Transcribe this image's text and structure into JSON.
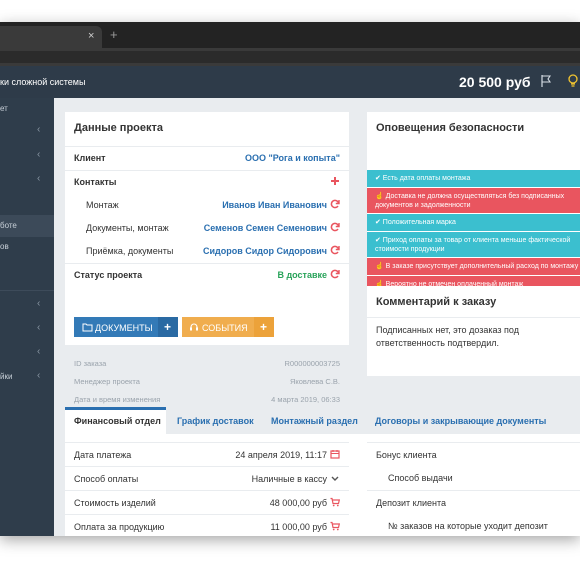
{
  "browser": {
    "tab_close": "×",
    "tab_new": "+"
  },
  "header": {
    "title": "ки сложной системы",
    "balance": "20 500 руб"
  },
  "sidebar": {
    "items": [
      {
        "label": "ет",
        "has_chevron": false
      },
      {
        "label": "",
        "has_chevron": true
      },
      {
        "label": "",
        "has_chevron": true
      },
      {
        "label": "",
        "has_chevron": true
      },
      {
        "label": "боте",
        "has_chevron": false
      },
      {
        "label": "ов",
        "has_chevron": false
      },
      {
        "label": "",
        "has_chevron": true
      },
      {
        "label": "",
        "has_chevron": true
      },
      {
        "label": "",
        "has_chevron": true
      },
      {
        "label": "йки",
        "has_chevron": true
      }
    ],
    "chevron": "‹"
  },
  "project": {
    "title": "Данные проекта",
    "client_label": "Клиент",
    "client_value": "ООО \"Рога и копыта\"",
    "contacts_label": "Контакты",
    "contacts": [
      {
        "role": "Монтаж",
        "name": "Иванов Иван Иванович"
      },
      {
        "role": "Документы, монтаж",
        "name": "Семенов Семен Семенович"
      },
      {
        "role": "Приёмка, документы",
        "name": "Сидоров Сидор Сидорович"
      }
    ],
    "status_label": "Статус проекта",
    "status_value": "В доставке",
    "docs_button": "ДОКУМЕНТЫ",
    "events_button": "СОБЫТИЯ",
    "plus": "+"
  },
  "order_meta": {
    "rows": [
      {
        "label": "ID заказа",
        "value": "R000000003725"
      },
      {
        "label": "Менеджер проекта",
        "value": "Яковлева С.В."
      },
      {
        "label": "Дата и время изменения",
        "value": "4 марта 2019, 06:33"
      }
    ]
  },
  "security": {
    "title": "Оповещения безопасности",
    "alerts": [
      {
        "type": "cyan",
        "text": "✔ Есть дата оплаты монтажа"
      },
      {
        "type": "red",
        "text": "☝ Доставка не должна осуществляться без подписанных документов и задолженности"
      },
      {
        "type": "cyan",
        "text": "✔ Положительная марка"
      },
      {
        "type": "cyan",
        "text": "✔ Приход оплаты за товар от клиента меньше фактической стоимости продукции"
      },
      {
        "type": "red",
        "text": "☝ В заказе присутствует дополнительный расход по монтажу"
      },
      {
        "type": "red",
        "text": "☝ Вероятно не отмечен оплаченный монтаж"
      }
    ]
  },
  "comment": {
    "title": "Комментарий к заказу",
    "text": "Подписанных нет, это дозаказ под ответственность подтвердил."
  },
  "tabs": [
    {
      "label": "Финансовый отдел",
      "active": true
    },
    {
      "label": "График доставок",
      "active": false
    },
    {
      "label": "Монтажный раздел",
      "active": false
    },
    {
      "label": "Договоры и закрывающие документы",
      "active": false
    }
  ],
  "finance": {
    "left": [
      {
        "label": "Дата платежа",
        "value": "24 апреля 2019, 11:17",
        "icon": "calendar-icon"
      },
      {
        "label": "Способ оплаты",
        "value": "Наличные в кассу",
        "icon": "dropdown-icon"
      },
      {
        "label": "Стоимость изделий",
        "value": "48 000,00 руб",
        "icon": "cart-icon"
      },
      {
        "label": "Оплата за продукцию",
        "value": "11 000,00 руб",
        "icon": "cart-icon"
      }
    ],
    "right": [
      {
        "label": "Бонус клиента",
        "indent": false
      },
      {
        "label": "Способ выдачи",
        "indent": true
      },
      {
        "label": "Депозит клиента",
        "indent": false
      },
      {
        "label": "№ заказов на которые уходит депозит",
        "indent": true
      }
    ]
  },
  "colors": {
    "accent": "#2a6fb0",
    "green": "#29a35a",
    "red": "#e9555f",
    "cyan": "#3bbfcf",
    "orange": "#f0ad4e",
    "header": "#2e3b49"
  }
}
